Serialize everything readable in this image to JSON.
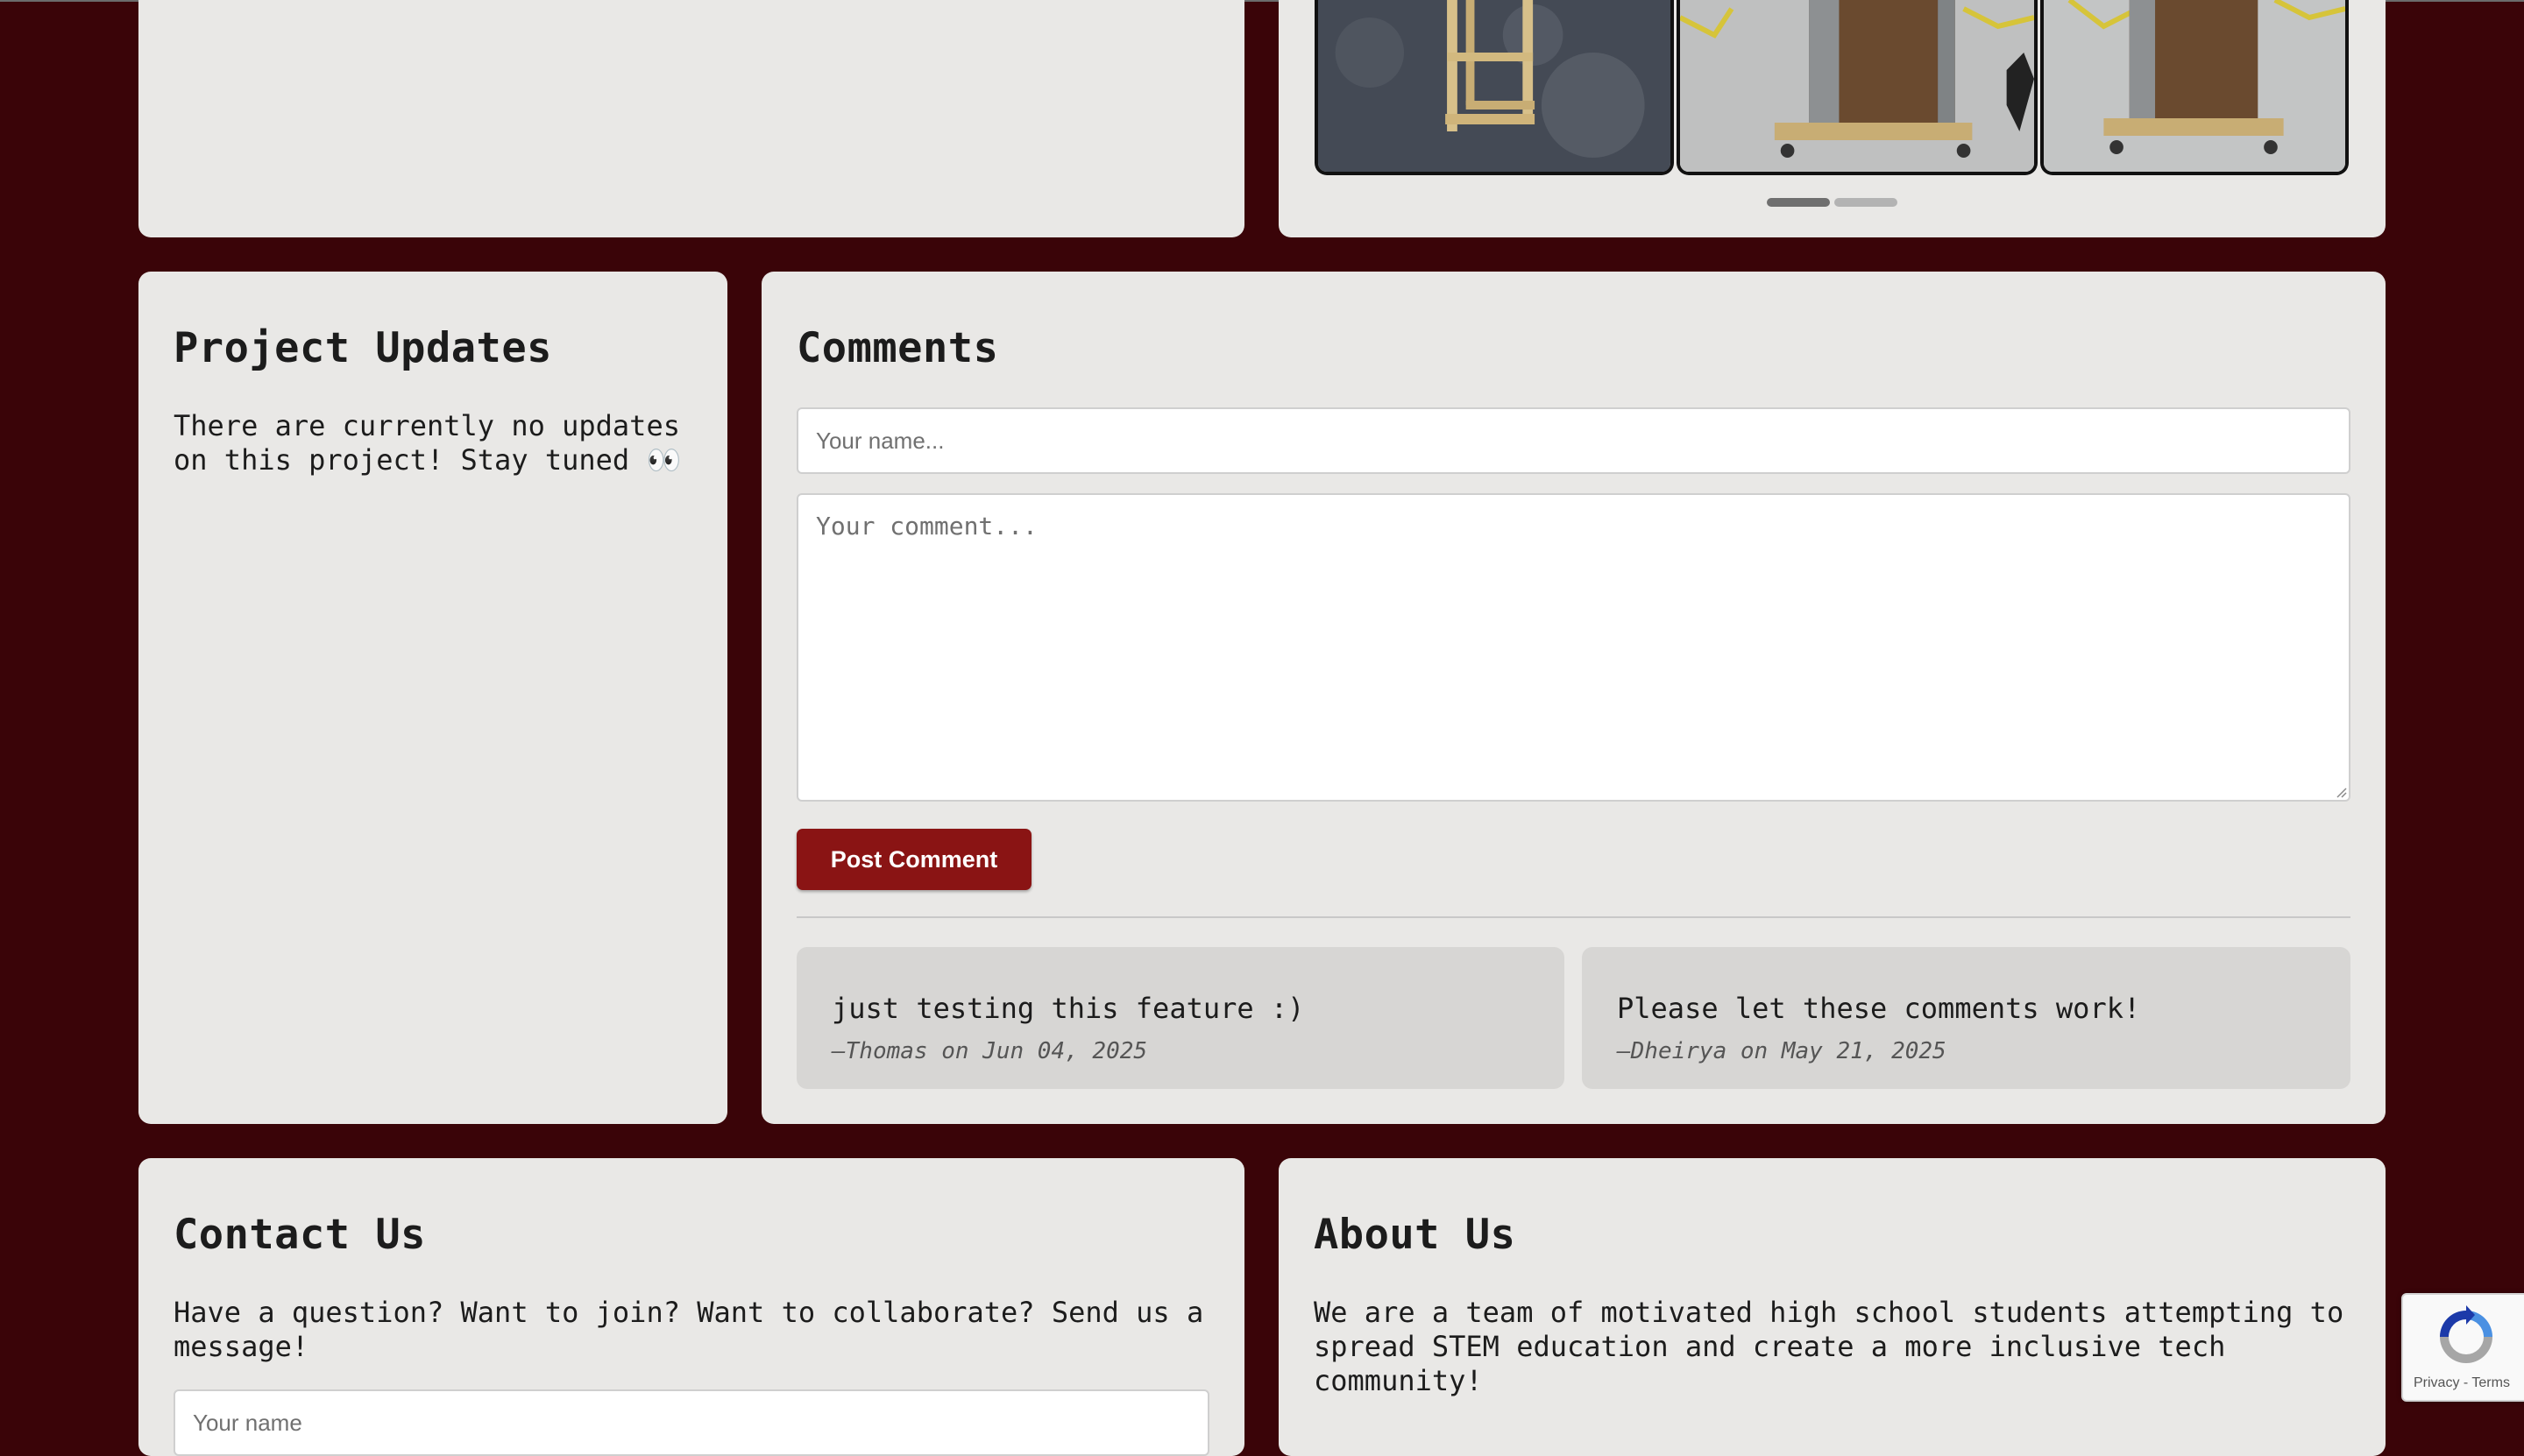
{
  "gallery": {
    "images": [
      {
        "alt": "wooden frame on asphalt"
      },
      {
        "alt": "podium on cart"
      },
      {
        "alt": "podium on cart"
      }
    ],
    "active_slide": 1,
    "slide_count": 2
  },
  "updates": {
    "title": "Project Updates",
    "text": "There are currently no updates on this project! Stay tuned 👀"
  },
  "comments": {
    "title": "Comments",
    "name_placeholder": "Your name...",
    "comment_placeholder": "Your comment...",
    "post_label": "Post Comment",
    "items": [
      {
        "text": "just testing this feature :)",
        "meta": "—Thomas on Jun 04, 2025"
      },
      {
        "text": "Please let these comments work!",
        "meta": "—Dheirya on May 21, 2025"
      }
    ]
  },
  "contact": {
    "title": "Contact Us",
    "text": "Have a question? Want to join? Want to collaborate? Send us a message!",
    "name_placeholder": "Your name"
  },
  "about": {
    "title": "About Us",
    "text": "We are a team of motivated high school students attempting to spread STEM education and create a more inclusive tech community!"
  },
  "recaptcha": {
    "terms": "Privacy - Terms"
  },
  "colors": {
    "background": "#3a0408",
    "card": "#e9e8e6",
    "accent": "#8a1414"
  }
}
